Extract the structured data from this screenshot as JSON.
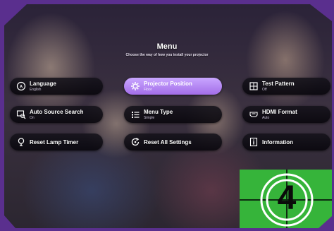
{
  "menu": {
    "title": "Menu",
    "subtitle": "Choose the way of how you install your projector"
  },
  "items": [
    {
      "label": "Language",
      "value": "English",
      "icon": "globe-icon"
    },
    {
      "label": "Projector Position",
      "value": "Floor",
      "icon": "gear-icon",
      "selected": true
    },
    {
      "label": "Test Pattern",
      "value": "Off",
      "icon": "grid-icon"
    },
    {
      "label": "Auto Source Search",
      "value": "On",
      "icon": "source-search-icon"
    },
    {
      "label": "Menu Type",
      "value": "Simple",
      "icon": "list-icon"
    },
    {
      "label": "HDMI Format",
      "value": "Auto",
      "icon": "hdmi-icon"
    },
    {
      "label": "Reset Lamp Timer",
      "icon": "lamp-icon"
    },
    {
      "label": "Reset All Settings",
      "icon": "reset-icon"
    },
    {
      "label": "Information",
      "icon": "info-icon"
    }
  ],
  "countdown": {
    "number": "4"
  },
  "colors": {
    "frame": "#5a2f8e",
    "selected": "#b88af5",
    "countdown_bg": "#36b43a"
  }
}
